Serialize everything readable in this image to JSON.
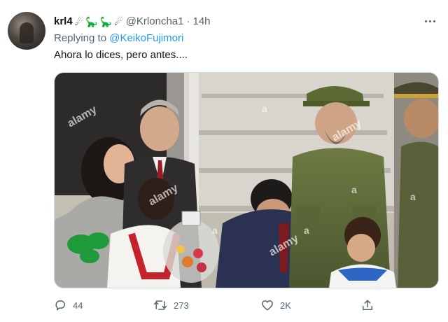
{
  "tweet": {
    "display_name": "krl4",
    "emoji": [
      "☄",
      "🦕",
      "🦕",
      "☄"
    ],
    "handle": "@Krloncha1",
    "separator": "·",
    "time": "14h",
    "reply_prefix": "Replying to",
    "reply_mention": "@KeikoFujimori",
    "text": "Ahora lo dices, pero antes....",
    "media": {
      "watermarks": [
        "alamy",
        "a",
        "alamy",
        "alamy",
        "alamy",
        "a",
        "a",
        "a",
        "a"
      ],
      "icon": "photo"
    }
  },
  "actions": {
    "reply": {
      "icon": "reply-icon",
      "count": "44"
    },
    "retweet": {
      "icon": "retweet-icon",
      "count": "273"
    },
    "like": {
      "icon": "heart-icon",
      "count": "2K"
    },
    "share": {
      "icon": "share-icon"
    }
  },
  "colors": {
    "accent": "#1d9bf0",
    "secondary_text": "#536471",
    "border": "#cfd9de"
  }
}
